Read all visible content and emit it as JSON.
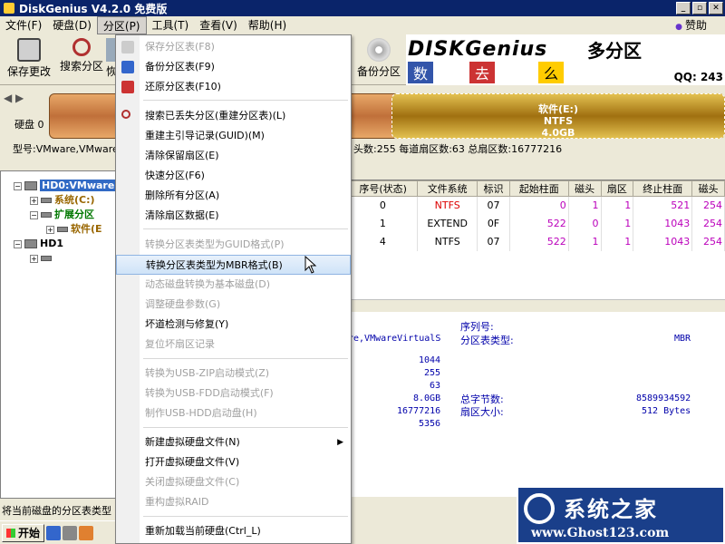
{
  "window": {
    "title": "DiskGenius V4.2.0 免费版"
  },
  "menubar": {
    "items": [
      "文件(F)",
      "硬盘(D)",
      "分区(P)",
      "工具(T)",
      "查看(V)",
      "帮助(H)"
    ],
    "sponsor": "赞助"
  },
  "toolbar": {
    "buttons": [
      "保存更改",
      "搜索分区",
      "恢",
      "备份分区"
    ],
    "banner_left": "DISKGenius",
    "banner_right": "多分区",
    "banner_chars": [
      "数",
      "去",
      "么"
    ],
    "qq": "QQ: 243"
  },
  "disk": {
    "nav": "◀ ▶",
    "label": "硬盘 0",
    "partition_name": "软件(E:)",
    "partition_fs": "NTFS",
    "partition_size": "4.0GB",
    "info_left": "型号:VMware,VMwareV",
    "info_right": "头数:255  每道扇区数:63  总扇区数:16777216"
  },
  "tree": {
    "hd0": "HD0:VMware,",
    "sys": "系统(C:)",
    "ext": "扩展分区",
    "soft": "软件(E",
    "hd1": "HD1"
  },
  "table": {
    "headers": [
      "序号(状态)",
      "文件系统",
      "标识",
      "起始柱面",
      "磁头",
      "扇区",
      "终止柱面",
      "磁头"
    ],
    "rows": [
      [
        "0",
        "NTFS",
        "07",
        "0",
        "1",
        "1",
        "521",
        "254"
      ],
      [
        "1",
        "EXTEND",
        "0F",
        "522",
        "0",
        "1",
        "1043",
        "254"
      ],
      [
        "4",
        "NTFS",
        "07",
        "522",
        "1",
        "1",
        "1043",
        "254"
      ]
    ]
  },
  "details": {
    "model": "re,VMwareVirtualS",
    "serial_label": "序列号:",
    "pt_type_label": "分区表类型:",
    "pt_type": "MBR",
    "cylinders": "1044",
    "heads": "255",
    "sectors": "63",
    "capacity": "8.0GB",
    "total_bytes_label": "总字节数:",
    "total_bytes": "8589934592",
    "total_sectors": "16777216",
    "sector_size_label": "扇区大小:",
    "sector_size": "512 Bytes",
    "extra": "5356"
  },
  "context_menu": {
    "items": [
      {
        "label": "保存分区表(F8)",
        "disabled": true
      },
      {
        "label": "备份分区表(F9)",
        "disabled": false
      },
      {
        "label": "还原分区表(F10)",
        "disabled": false
      },
      {
        "label": "搜索已丢失分区(重建分区表)(L)",
        "disabled": false
      },
      {
        "label": "重建主引导记录(GUID)(M)",
        "disabled": false
      },
      {
        "label": "清除保留扇区(E)",
        "disabled": false
      },
      {
        "label": "快速分区(F6)",
        "disabled": false
      },
      {
        "label": "删除所有分区(A)",
        "disabled": false
      },
      {
        "label": "清除扇区数据(E)",
        "disabled": false
      },
      {
        "label": "转换分区表类型为GUID格式(P)",
        "disabled": true
      },
      {
        "label": "转换分区表类型为MBR格式(B)",
        "disabled": false
      },
      {
        "label": "动态磁盘转换为基本磁盘(D)",
        "disabled": true
      },
      {
        "label": "调整硬盘参数(G)",
        "disabled": true
      },
      {
        "label": "坏道检测与修复(Y)",
        "disabled": false
      },
      {
        "label": "复位坏扇区记录",
        "disabled": true
      },
      {
        "label": "转换为USB-ZIP启动模式(Z)",
        "disabled": true
      },
      {
        "label": "转换为USB-FDD启动模式(F)",
        "disabled": true
      },
      {
        "label": "制作USB-HDD启动盘(H)",
        "disabled": true
      },
      {
        "label": "新建虚拟硬盘文件(N)",
        "disabled": false
      },
      {
        "label": "打开虚拟硬盘文件(V)",
        "disabled": false
      },
      {
        "label": "关闭虚拟硬盘文件(C)",
        "disabled": true
      },
      {
        "label": "重构虚拟RAID",
        "disabled": true
      },
      {
        "label": "重新加载当前硬盘(Ctrl_L)",
        "disabled": false
      }
    ]
  },
  "statusbar": {
    "text": "将当前磁盘的分区表类型"
  },
  "taskbar": {
    "start": "开始"
  },
  "watermark": {
    "title": "系统之家",
    "url": "www.Ghost123.com"
  },
  "colors": {
    "title_bg": "#0a246a",
    "disk_bar": "#c0703a",
    "partition": "#a07010",
    "highlight": "#cfe3f8",
    "ntfs_red": "#dd0000",
    "value_magenta": "#bb00bb"
  }
}
